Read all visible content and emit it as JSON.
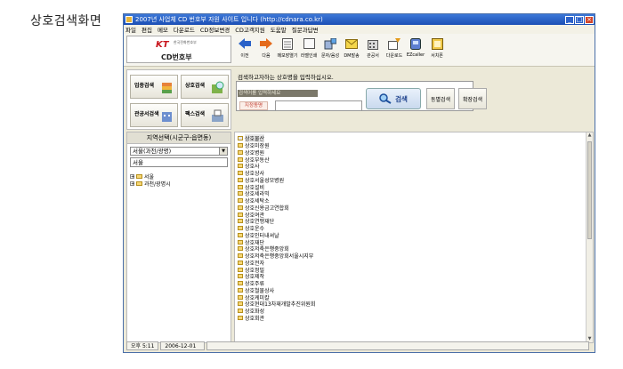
{
  "caption": "상호검색화면",
  "window": {
    "title": "2007년 사업체 CD 번호부 자원 사이트 입니다 (http://cdnara.co.kr)"
  },
  "menu": [
    "파일",
    "편집",
    "메모",
    "다운로드",
    "CD정보변경",
    "CD고객지원",
    "도움말",
    "질문과답변"
  ],
  "logo": {
    "brand": "KT",
    "subtitle": "한국전화번호부",
    "product": "CD번호부"
  },
  "toolbar": [
    {
      "label": "이전",
      "icon": "back-arrow-icon"
    },
    {
      "label": "다음",
      "icon": "forward-arrow-icon"
    },
    {
      "label": "메모장열기",
      "icon": "notepad-icon"
    },
    {
      "label": "라벨인쇄",
      "icon": "label-print-icon"
    },
    {
      "label": "문자/음성",
      "icon": "phone-message-icon"
    },
    {
      "label": "DM발송",
      "icon": "mail-icon"
    },
    {
      "label": "관공서",
      "icon": "building-icon"
    },
    {
      "label": "다운로드",
      "icon": "download-icon"
    },
    {
      "label": "EZcaller",
      "icon": "caller-icon"
    },
    {
      "label": "서치폰",
      "icon": "search-phone-icon"
    }
  ],
  "leftButtons": [
    {
      "label": "업종검색",
      "icon": "category-search-icon"
    },
    {
      "label": "상호검색",
      "icon": "name-search-icon"
    },
    {
      "label": "관공서검색",
      "icon": "office-search-icon"
    },
    {
      "label": "팩스검색",
      "icon": "fax-search-icon"
    }
  ],
  "search": {
    "prompt": "검색하고자하는 상호명을 입력하십시오.",
    "inputValue": "검색어를 입력하세요",
    "areaLabel": "지정동명",
    "areaValue": "",
    "searchButton": "검색",
    "dongButton": "동별검색",
    "expandButton": "확장검색"
  },
  "region": {
    "title": "지역선택(시군구-읍면동)",
    "selected": "서울(과천/광명)",
    "value": "서울",
    "tree": [
      {
        "label": "서울"
      },
      {
        "label": "과천/광명시"
      }
    ]
  },
  "results": [
    "상호물산",
    "상호미장원",
    "상호병원",
    "상호부동산",
    "상호사",
    "상호상사",
    "상호서울성모병원",
    "상호설비",
    "상호세라믹",
    "상호세탁소",
    "상호신용금고연합회",
    "상호여관",
    "상호연맹재단",
    "상호운수",
    "상호인터내셔날",
    "상호재단",
    "상호저축은행중앙회",
    "상호저축은행중앙회서울시지부",
    "상호전자",
    "상호정밀",
    "상호제작",
    "상호주류",
    "상호철물상사",
    "상호케미칼",
    "상호현대13차재개발추진위원회",
    "상호화성",
    "상호회관"
  ],
  "status": {
    "time": "오후 5:11",
    "date": "2006-12-01"
  }
}
